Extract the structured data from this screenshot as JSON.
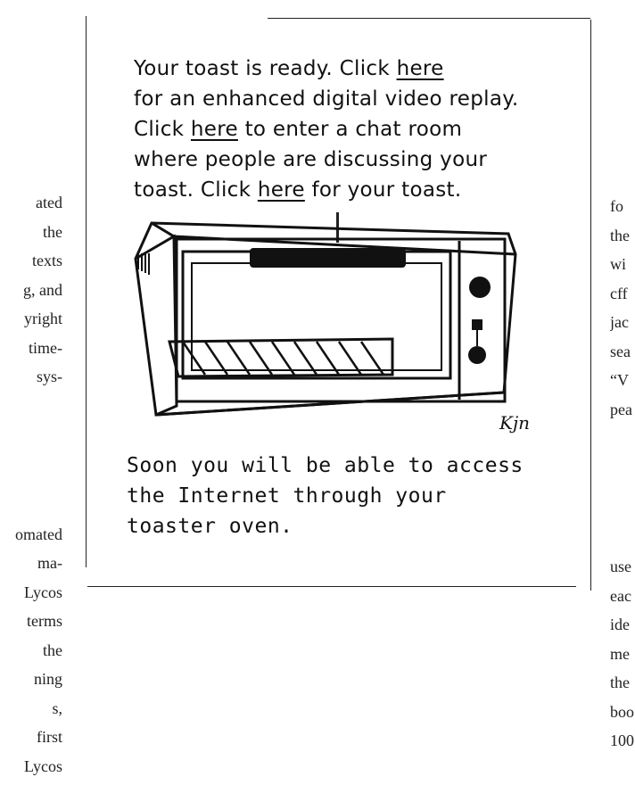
{
  "left_column": {
    "lines_a": [
      "ated",
      "the",
      "texts",
      "g, and",
      "yright",
      "time-",
      "sys-"
    ],
    "lines_b": [
      "omated",
      "ma-",
      "Lycos",
      "terms",
      "the",
      "ning",
      "s,",
      "first",
      "Lycos"
    ]
  },
  "right_column": {
    "lines_a": [
      "fo",
      "the",
      "wi",
      "cff",
      "jac",
      "sea",
      "“V",
      "pea"
    ],
    "lines_b": [
      "use",
      "eac",
      "ide",
      "me",
      "the",
      "boo",
      "100"
    ]
  },
  "cartoon": {
    "caption_top_lines": [
      [
        "Your toast is ready. Click ",
        {
          "u": "here"
        }
      ],
      [
        "for an enhanced digital video replay."
      ],
      [
        "Click ",
        {
          "u": "here"
        },
        " to enter a chat room"
      ],
      [
        "where people are discussing your"
      ],
      [
        "toast. Click ",
        {
          "u": "here"
        },
        " for your toast."
      ]
    ],
    "caption_bottom_lines": [
      "Soon you will be able to access",
      "the Internet through your",
      "toaster oven."
    ],
    "signature": "Kjn"
  }
}
